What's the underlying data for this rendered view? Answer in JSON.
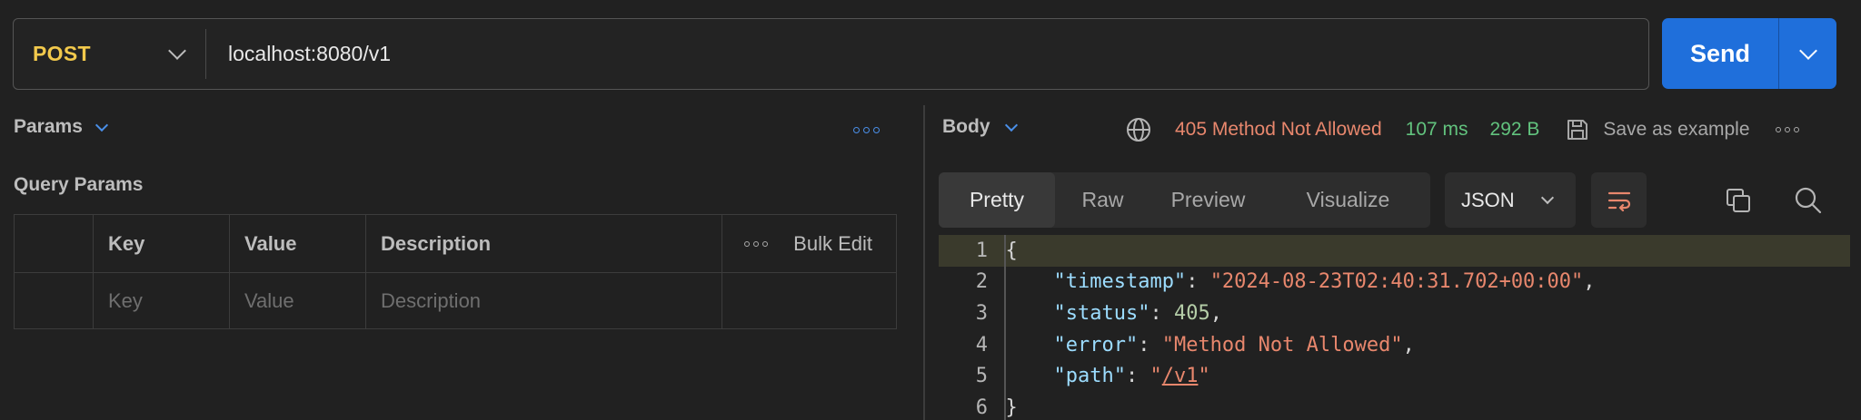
{
  "request": {
    "method": "POST",
    "url": "localhost:8080/v1",
    "send_label": "Send"
  },
  "left": {
    "tab_label": "Params",
    "query_title": "Query Params",
    "headers": [
      "Key",
      "Value",
      "Description"
    ],
    "bulk_edit": "Bulk Edit",
    "placeholders": [
      "Key",
      "Value",
      "Description"
    ]
  },
  "response": {
    "tab_label": "Body",
    "status": "405 Method Not Allowed",
    "time": "107 ms",
    "size": "292 B",
    "save_label": "Save as example",
    "view_tabs": [
      "Pretty",
      "Raw",
      "Preview",
      "Visualize"
    ],
    "format": "JSON",
    "lines": [
      {
        "n": "1",
        "parts": [
          {
            "t": "{",
            "c": ""
          }
        ]
      },
      {
        "n": "2",
        "parts": [
          {
            "t": "    ",
            "c": ""
          },
          {
            "t": "\"timestamp\"",
            "c": "k"
          },
          {
            "t": ": ",
            "c": ""
          },
          {
            "t": "\"2024-08-23T02:40:31.702+00:00\"",
            "c": "s"
          },
          {
            "t": ",",
            "c": ""
          }
        ]
      },
      {
        "n": "3",
        "parts": [
          {
            "t": "    ",
            "c": ""
          },
          {
            "t": "\"status\"",
            "c": "k"
          },
          {
            "t": ": ",
            "c": ""
          },
          {
            "t": "405",
            "c": "n"
          },
          {
            "t": ",",
            "c": ""
          }
        ]
      },
      {
        "n": "4",
        "parts": [
          {
            "t": "    ",
            "c": ""
          },
          {
            "t": "\"error\"",
            "c": "k"
          },
          {
            "t": ": ",
            "c": ""
          },
          {
            "t": "\"Method Not Allowed\"",
            "c": "s"
          },
          {
            "t": ",",
            "c": ""
          }
        ]
      },
      {
        "n": "5",
        "parts": [
          {
            "t": "    ",
            "c": ""
          },
          {
            "t": "\"path\"",
            "c": "k"
          },
          {
            "t": ": ",
            "c": ""
          },
          {
            "t": "\"",
            "c": "s"
          },
          {
            "t": "/v1",
            "c": "s u"
          },
          {
            "t": "\"",
            "c": "s"
          }
        ]
      },
      {
        "n": "6",
        "parts": [
          {
            "t": "}",
            "c": ""
          }
        ]
      }
    ]
  },
  "colors": {
    "method": "#f2c94c",
    "send": "#1f6fdb",
    "status_error": "#e8876d",
    "status_ok": "#62c37e"
  }
}
